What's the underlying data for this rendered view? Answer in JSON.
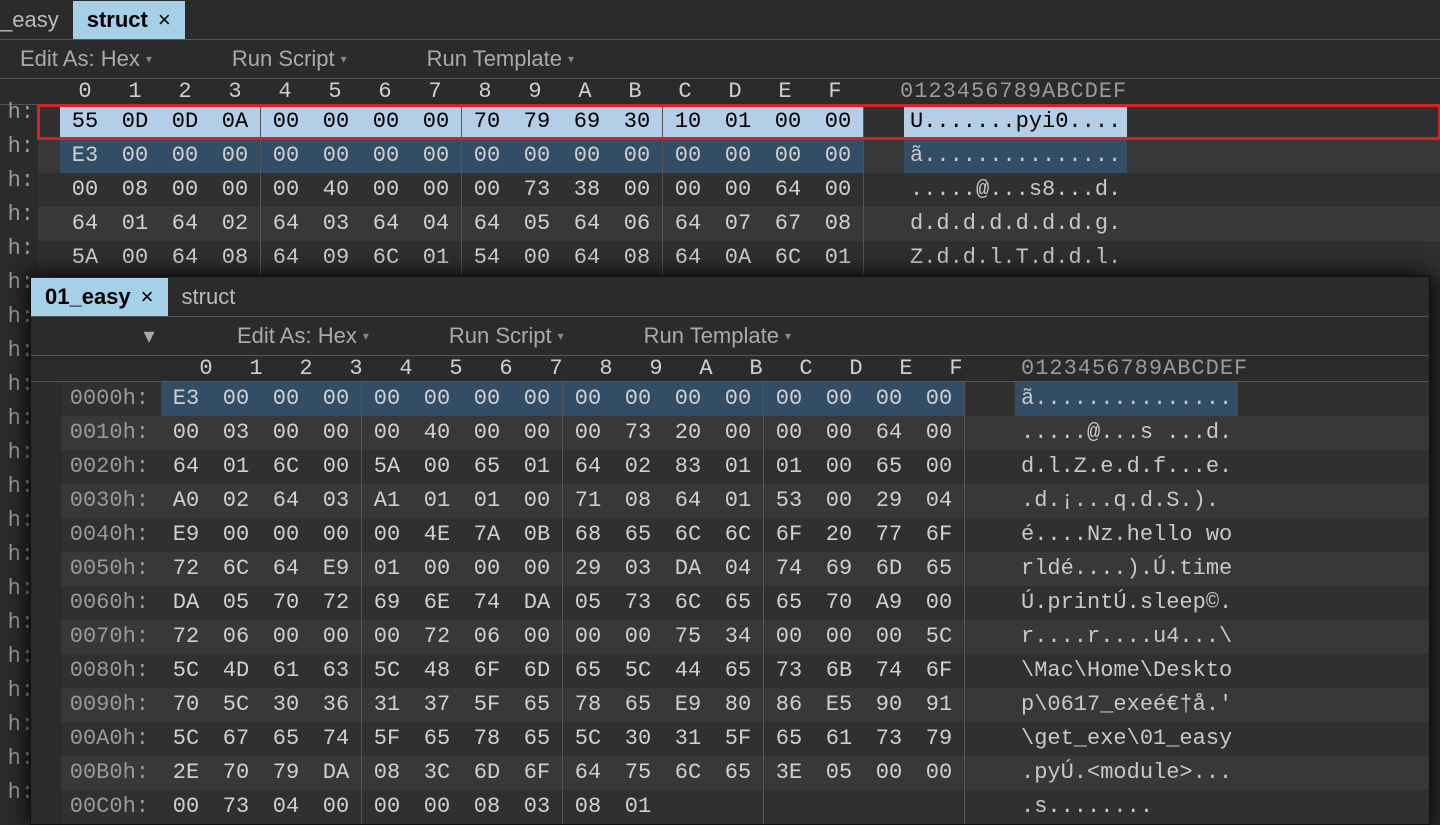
{
  "top": {
    "tabs": {
      "left_partial": "_easy",
      "active": "struct"
    },
    "toolbar": {
      "edit_as": "Edit As: Hex",
      "run_script": "Run Script",
      "run_template": "Run Template"
    },
    "col_ruler": [
      "0",
      "1",
      "2",
      "3",
      "4",
      "5",
      "6",
      "7",
      "8",
      "9",
      "A",
      "B",
      "C",
      "D",
      "E",
      "F"
    ],
    "asc_ruler": "0123456789ABCDEF",
    "gutter": [
      "h:",
      "h:",
      "h:",
      "h:",
      "h:",
      "h:",
      "h:",
      "h:",
      "h:",
      "h:",
      "h:",
      "h:",
      "h:",
      "h:",
      "h:",
      "h:",
      "h:",
      "h:",
      "h:",
      "h:",
      "h:"
    ],
    "rows": [
      {
        "hex": [
          "55",
          "0D",
          "0D",
          "0A",
          "00",
          "00",
          "00",
          "00",
          "70",
          "79",
          "69",
          "30",
          "10",
          "01",
          "00",
          "00"
        ],
        "asc": "U.......pyi0....",
        "hl": "red"
      },
      {
        "hex": [
          "E3",
          "00",
          "00",
          "00",
          "00",
          "00",
          "00",
          "00",
          "00",
          "00",
          "00",
          "00",
          "00",
          "00",
          "00",
          "00"
        ],
        "asc": "ã...............",
        "hl": "blue"
      },
      {
        "hex": [
          "00",
          "08",
          "00",
          "00",
          "00",
          "40",
          "00",
          "00",
          "00",
          "73",
          "38",
          "00",
          "00",
          "00",
          "64",
          "00"
        ],
        "asc": ".....@...s8...d."
      },
      {
        "hex": [
          "64",
          "01",
          "64",
          "02",
          "64",
          "03",
          "64",
          "04",
          "64",
          "05",
          "64",
          "06",
          "64",
          "07",
          "67",
          "08"
        ],
        "asc": "d.d.d.d.d.d.d.g."
      },
      {
        "hex": [
          "5A",
          "00",
          "64",
          "08",
          "64",
          "09",
          "6C",
          "01",
          "54",
          "00",
          "64",
          "08",
          "64",
          "0A",
          "6C",
          "01"
        ],
        "asc": "Z.d.d.l.T.d.d.l."
      }
    ]
  },
  "bottom": {
    "tabs": {
      "active": "01_easy",
      "other": "struct"
    },
    "toolbar": {
      "edit_as": "Edit As: Hex",
      "run_script": "Run Script",
      "run_template": "Run Template"
    },
    "col_ruler": [
      "0",
      "1",
      "2",
      "3",
      "4",
      "5",
      "6",
      "7",
      "8",
      "9",
      "A",
      "B",
      "C",
      "D",
      "E",
      "F"
    ],
    "asc_ruler": "0123456789ABCDEF",
    "rows": [
      {
        "off": "0000h:",
        "hex": [
          "E3",
          "00",
          "00",
          "00",
          "00",
          "00",
          "00",
          "00",
          "00",
          "00",
          "00",
          "00",
          "00",
          "00",
          "00",
          "00"
        ],
        "asc": "ã...............",
        "hl": "blue"
      },
      {
        "off": "0010h:",
        "hex": [
          "00",
          "03",
          "00",
          "00",
          "00",
          "40",
          "00",
          "00",
          "00",
          "73",
          "20",
          "00",
          "00",
          "00",
          "64",
          "00"
        ],
        "asc": ".....@...s ...d."
      },
      {
        "off": "0020h:",
        "hex": [
          "64",
          "01",
          "6C",
          "00",
          "5A",
          "00",
          "65",
          "01",
          "64",
          "02",
          "83",
          "01",
          "01",
          "00",
          "65",
          "00"
        ],
        "asc": "d.l.Z.e.d.f...e."
      },
      {
        "off": "0030h:",
        "hex": [
          "A0",
          "02",
          "64",
          "03",
          "A1",
          "01",
          "01",
          "00",
          "71",
          "08",
          "64",
          "01",
          "53",
          "00",
          "29",
          "04"
        ],
        "asc": ".d.¡...q.d.S.)."
      },
      {
        "off": "0040h:",
        "hex": [
          "E9",
          "00",
          "00",
          "00",
          "00",
          "4E",
          "7A",
          "0B",
          "68",
          "65",
          "6C",
          "6C",
          "6F",
          "20",
          "77",
          "6F"
        ],
        "asc": "é....Nz.hello wo"
      },
      {
        "off": "0050h:",
        "hex": [
          "72",
          "6C",
          "64",
          "E9",
          "01",
          "00",
          "00",
          "00",
          "29",
          "03",
          "DA",
          "04",
          "74",
          "69",
          "6D",
          "65"
        ],
        "asc": "rldé....).Ú.time"
      },
      {
        "off": "0060h:",
        "hex": [
          "DA",
          "05",
          "70",
          "72",
          "69",
          "6E",
          "74",
          "DA",
          "05",
          "73",
          "6C",
          "65",
          "65",
          "70",
          "A9",
          "00"
        ],
        "asc": "Ú.printÚ.sleep©."
      },
      {
        "off": "0070h:",
        "hex": [
          "72",
          "06",
          "00",
          "00",
          "00",
          "72",
          "06",
          "00",
          "00",
          "00",
          "75",
          "34",
          "00",
          "00",
          "00",
          "5C"
        ],
        "asc": "r....r....u4...\\"
      },
      {
        "off": "0080h:",
        "hex": [
          "5C",
          "4D",
          "61",
          "63",
          "5C",
          "48",
          "6F",
          "6D",
          "65",
          "5C",
          "44",
          "65",
          "73",
          "6B",
          "74",
          "6F"
        ],
        "asc": "\\Mac\\Home\\Deskto"
      },
      {
        "off": "0090h:",
        "hex": [
          "70",
          "5C",
          "30",
          "36",
          "31",
          "37",
          "5F",
          "65",
          "78",
          "65",
          "E9",
          "80",
          "86",
          "E5",
          "90",
          "91"
        ],
        "asc": "p\\0617_exeé€†å.'"
      },
      {
        "off": "00A0h:",
        "hex": [
          "5C",
          "67",
          "65",
          "74",
          "5F",
          "65",
          "78",
          "65",
          "5C",
          "30",
          "31",
          "5F",
          "65",
          "61",
          "73",
          "79"
        ],
        "asc": "\\get_exe\\01_easy"
      },
      {
        "off": "00B0h:",
        "hex": [
          "2E",
          "70",
          "79",
          "DA",
          "08",
          "3C",
          "6D",
          "6F",
          "64",
          "75",
          "6C",
          "65",
          "3E",
          "05",
          "00",
          "00"
        ],
        "asc": ".pyÚ.<module>..."
      },
      {
        "off": "00C0h:",
        "hex": [
          "00",
          "73",
          "04",
          "00",
          "00",
          "00",
          "08",
          "03",
          "08",
          "01",
          "",
          "",
          "",
          "",
          "",
          ""
        ],
        "asc": ".s........"
      }
    ]
  }
}
